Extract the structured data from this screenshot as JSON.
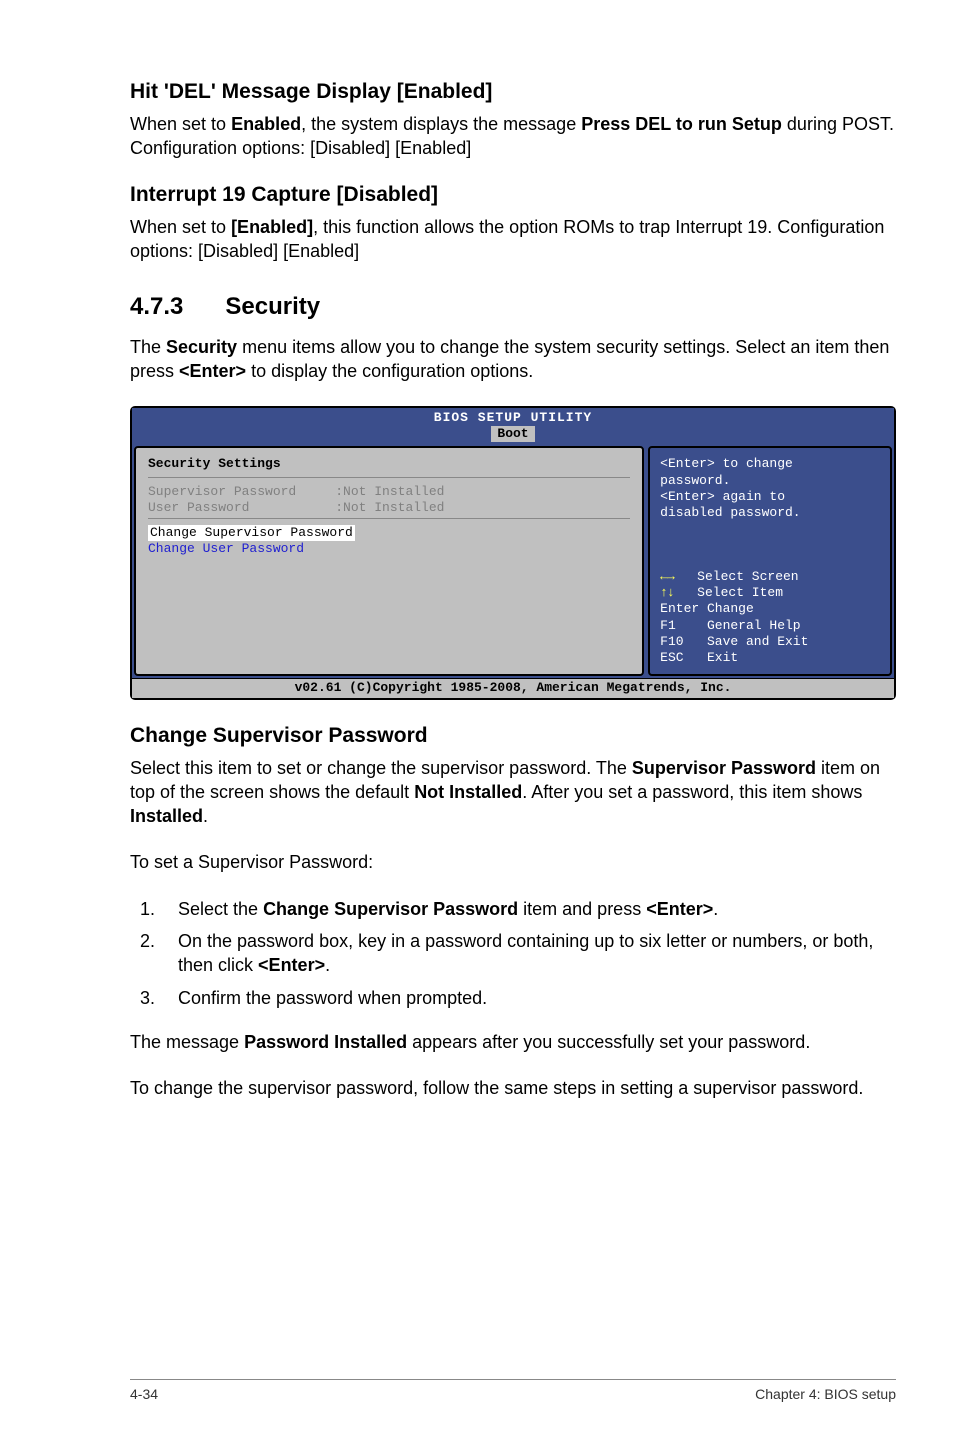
{
  "section1": {
    "heading": "Hit 'DEL' Message Display [Enabled]",
    "text_pre": "When set to ",
    "bold1": "Enabled",
    "text_mid": ", the system displays the message ",
    "bold2": "Press DEL to run Setup",
    "text_post": " during POST. Configuration options: [Disabled] [Enabled]"
  },
  "section2": {
    "heading": "Interrupt 19 Capture [Disabled]",
    "text_pre": "When set to ",
    "bold1": "[Enabled]",
    "text_post": ", this function allows the option ROMs to trap Interrupt 19. Configuration options: [Disabled] [Enabled]"
  },
  "section3": {
    "number": "4.7.3",
    "title": "Security",
    "intro_pre": "The ",
    "intro_bold1": "Security",
    "intro_mid": " menu items allow you to change the system security settings. Select an item then press ",
    "intro_bold2": "<Enter>",
    "intro_post": " to display the configuration options."
  },
  "bios": {
    "title": "BIOS SETUP UTILITY",
    "tab": "Boot",
    "left": {
      "settings_title": "Security Settings",
      "row1": "Supervisor Password     :Not Installed",
      "row2": "User Password           :Not Installed",
      "sel_row": "Change Supervisor Password",
      "row4": "Change User Password"
    },
    "right": {
      "help1": "<Enter> to change",
      "help2": "password.",
      "help3": "<Enter> again to",
      "help4": "disabled password."
    },
    "legend": {
      "l1_arrows": "←→",
      "l1_label": "   Select Screen",
      "l2_arrows": "↑↓",
      "l2_label": "   Select Item",
      "l3": "Enter Change",
      "l4": "F1    General Help",
      "l5": "F10   Save and Exit",
      "l6": "ESC   Exit"
    },
    "footer": "v02.61 (C)Copyright 1985-2008, American Megatrends, Inc."
  },
  "section4": {
    "heading": "Change Supervisor Password",
    "p1_pre": "Select this item to set or change the supervisor password. The ",
    "p1_b1": "Supervisor Password",
    "p1_mid": " item on top of the screen shows the default ",
    "p1_b2": "Not Installed",
    "p1_mid2": ". After you set a password, this item shows ",
    "p1_b3": "Installed",
    "p1_post": ".",
    "p2": "To set a Supervisor Password:",
    "steps": {
      "s1_pre": "Select the ",
      "s1_b1": "Change Supervisor Password",
      "s1_mid": " item and press ",
      "s1_b2": "<Enter>",
      "s1_post": ".",
      "s2_pre": "On the password box, key in a password containing up to six letter or numbers, or both, then click ",
      "s2_b1": "<Enter>",
      "s2_post": ".",
      "s3": "Confirm the password when prompted."
    },
    "p3_pre": "The message ",
    "p3_b1": "Password Installed",
    "p3_post": " appears after you successfully set your password.",
    "p4": "To change the supervisor password, follow the same steps in setting a supervisor password."
  },
  "footer": {
    "left": "4-34",
    "right": "Chapter 4: BIOS setup"
  }
}
